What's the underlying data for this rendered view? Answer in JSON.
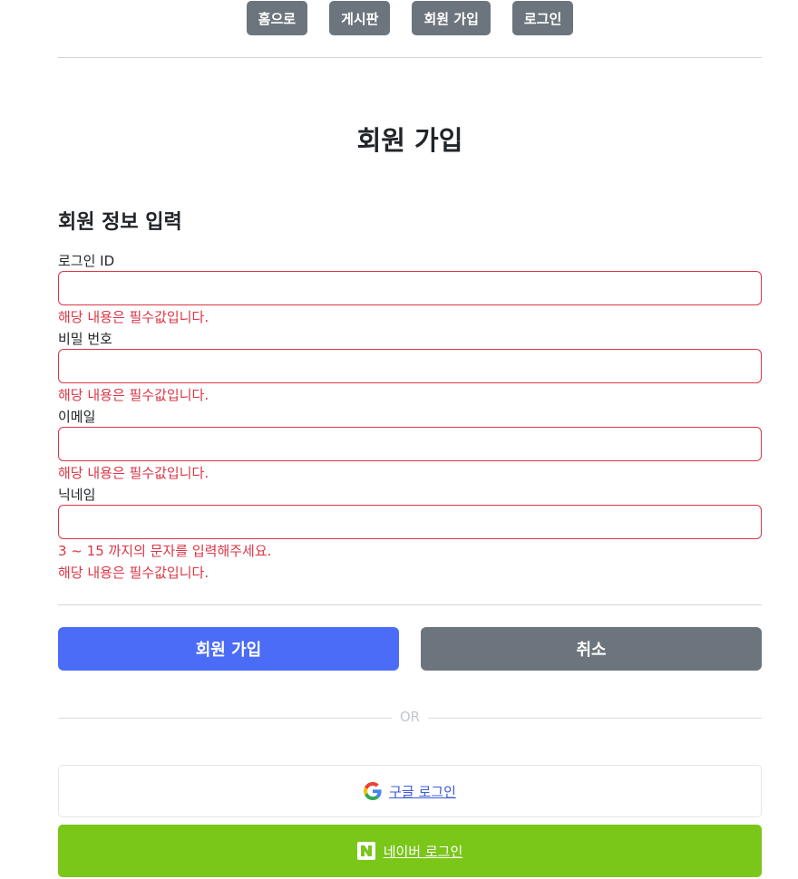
{
  "nav": {
    "home": "홈으로",
    "board": "게시판",
    "signup": "회원 가입",
    "login": "로그인"
  },
  "page_title": "회원 가입",
  "section_title": "회원 정보 입력",
  "form": {
    "login_id": {
      "label": "로그인 ID",
      "value": "",
      "error": "해당 내용은 필수값입니다."
    },
    "password": {
      "label": "비밀 번호",
      "value": "",
      "error": "해당 내용은 필수값입니다."
    },
    "email": {
      "label": "이메일",
      "value": "",
      "error": "해당 내용은 필수값입니다."
    },
    "nickname": {
      "label": "닉네임",
      "value": "",
      "error_length": "3 ~ 15 까지의 문자를 입력해주세요.",
      "error": "해당 내용은 필수값입니다."
    }
  },
  "actions": {
    "submit": "회원 가입",
    "cancel": "취소"
  },
  "divider_text": "OR",
  "social": {
    "google": {
      "label": "구글 로그인",
      "icon": "google-logo-icon"
    },
    "naver": {
      "label": "네이버 로그인",
      "icon": "naver-logo-icon",
      "color": "#7ac619"
    }
  },
  "colors": {
    "primary": "#4a6cf7",
    "secondary": "#6c757d",
    "error": "#dc3545"
  }
}
